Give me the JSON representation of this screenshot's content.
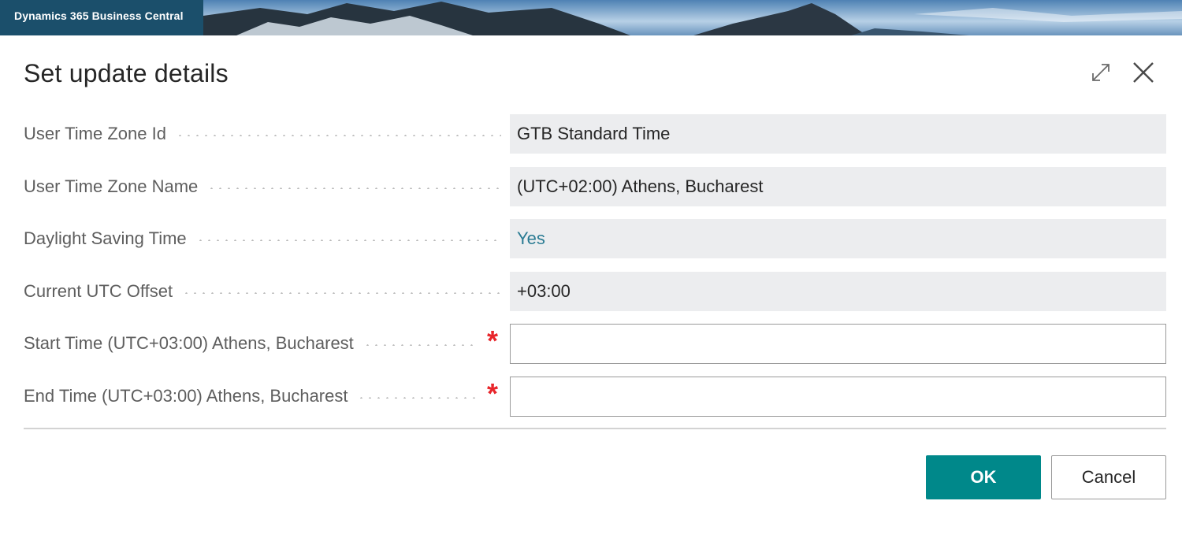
{
  "app": {
    "title": "Dynamics 365 Business Central"
  },
  "dialog": {
    "title": "Set update details",
    "icons": {
      "expand": "expand-icon",
      "close": "close-icon"
    },
    "fields": [
      {
        "label": "User Time Zone Id",
        "value": "GTB Standard Time",
        "type": "readonly",
        "required": false
      },
      {
        "label": "User Time Zone Name",
        "value": "(UTC+02:00) Athens, Bucharest",
        "type": "readonly",
        "required": false
      },
      {
        "label": "Daylight Saving Time",
        "value": "Yes",
        "type": "readonly-link",
        "required": false
      },
      {
        "label": "Current UTC Offset",
        "value": "+03:00",
        "type": "readonly",
        "required": false
      },
      {
        "label": "Start Time (UTC+03:00) Athens, Bucharest",
        "value": "",
        "type": "input",
        "required": true
      },
      {
        "label": "End Time (UTC+03:00) Athens, Bucharest",
        "value": "",
        "type": "input",
        "required": true
      }
    ],
    "required_marker": "*",
    "buttons": {
      "ok": "OK",
      "cancel": "Cancel"
    }
  },
  "colors": {
    "accent": "#00888a",
    "link": "#2a7b93",
    "required": "#e8262b",
    "readonly_bg": "#ecedef"
  }
}
